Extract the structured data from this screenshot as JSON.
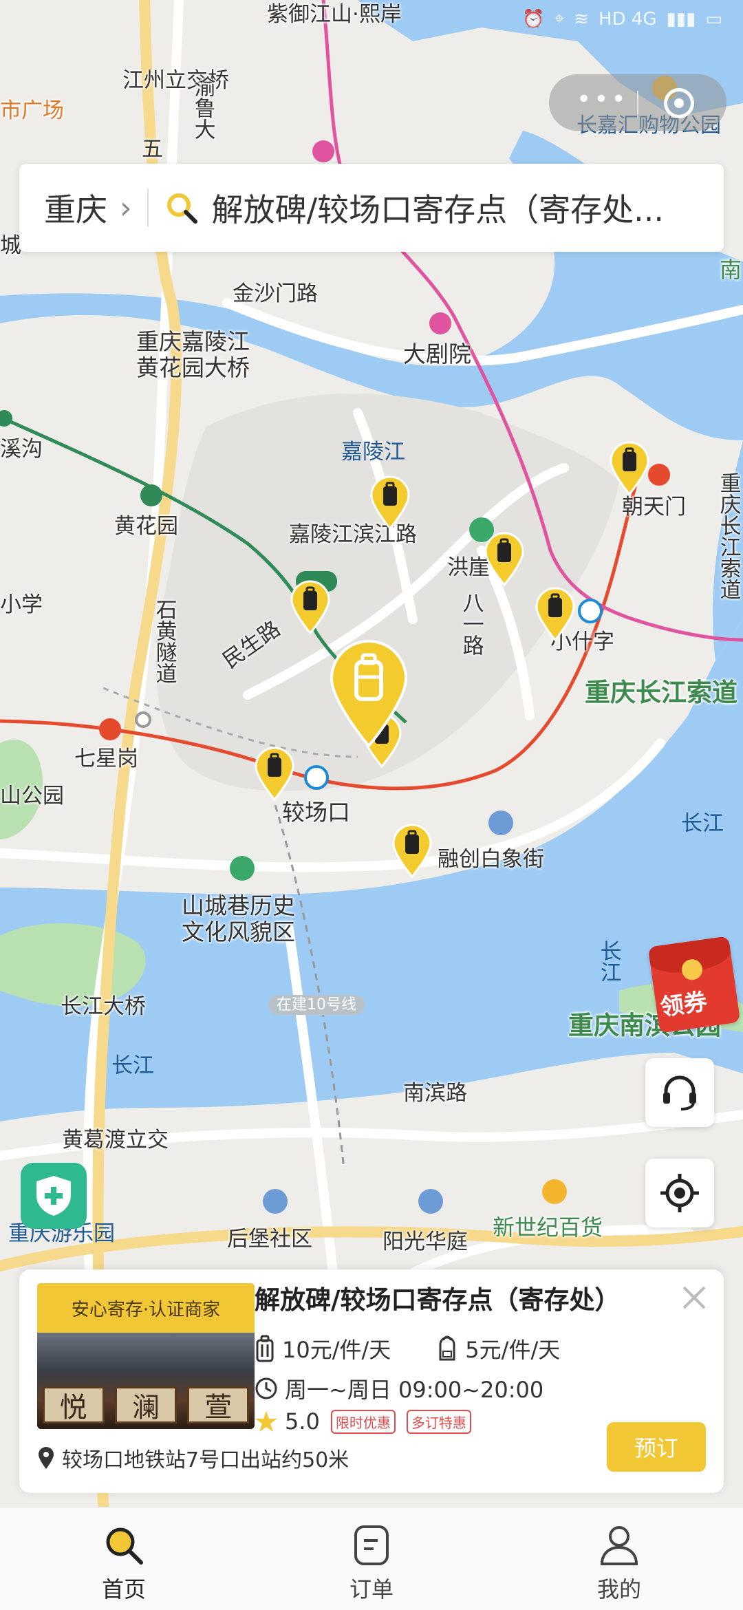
{
  "status_bar": {
    "time": "",
    "indicators": "HD 4G"
  },
  "search": {
    "city": "重庆",
    "query": "解放碑/较场口寄存点（寄存处..."
  },
  "map_labels": {
    "ziyu": "紫御江山·熙岸",
    "jiangzhou": "江州立交桥",
    "yuao": "渝鲁大",
    "wu": "五",
    "shiguang": "市广场",
    "changjiahui": "长嘉汇购物公园",
    "cheng": "城",
    "jinshamen": "金沙门路",
    "huanghuayuan_bridge": "重庆嘉陵江\n黄花园大桥",
    "dajuyuan": "大剧院",
    "xigou": "溪沟",
    "jialingjiang": "嘉陵江",
    "chaotianmen": "朝天门",
    "huanghuayuan": "黄花园",
    "jialingjiang_road": "嘉陵江滨江路",
    "hongya": "洪崖",
    "xiaoxue": "小学",
    "shihuang": "石黄隧道",
    "minsheng": "民生路",
    "bayi": "八一路",
    "xiaoshizi": "小什字",
    "suodao": "重庆长江索道",
    "qixinggang": "七星岗",
    "jiaochangkou": "较场口",
    "shan_park": "山公园",
    "changjiang_east": "长江",
    "rongchuang": "融创白象街",
    "shanchengxiang": "山城巷历史\n文化风貌区",
    "changjiang_bridge": "长江大桥",
    "line10": "在建10号线",
    "changjiang_v": "长江",
    "nanbin_park": "重庆南滨公园",
    "changjiang_south": "长江",
    "nanbin_road": "南滨路",
    "huanggedu": "黄葛渡立交",
    "houbao": "后堡社区",
    "yangguang": "阳光华庭",
    "xinshiji": "新世纪百货",
    "youleyuan": "重庆游乐园",
    "nan": "南",
    "chongtop": "重"
  },
  "coupon": {
    "label": "领券"
  },
  "card": {
    "badge": "安心寄存·认证商家",
    "sign_chars": [
      "悦",
      "澜",
      "萱"
    ],
    "title": "解放碑/较场口寄存点（寄存处）",
    "price_luggage": "10元/件/天",
    "price_bag": "5元/件/天",
    "hours": "周一~周日 09:00~20:00",
    "rating": "5.0",
    "tag1": "限时优惠",
    "tag2": "多订特惠",
    "location": "较场口地铁站7号口出站约50米",
    "book": "预订"
  },
  "tabs": [
    {
      "label": "首页",
      "icon": "search-icon",
      "active": true
    },
    {
      "label": "订单",
      "icon": "order-icon",
      "active": false
    },
    {
      "label": "我的",
      "icon": "user-icon",
      "active": false
    }
  ],
  "colors": {
    "accent": "#f2c736",
    "water": "#9ecbf3",
    "metro_red": "#e64a2e",
    "metro_green": "#2f8a57",
    "metro_pink": "#e0539f"
  }
}
